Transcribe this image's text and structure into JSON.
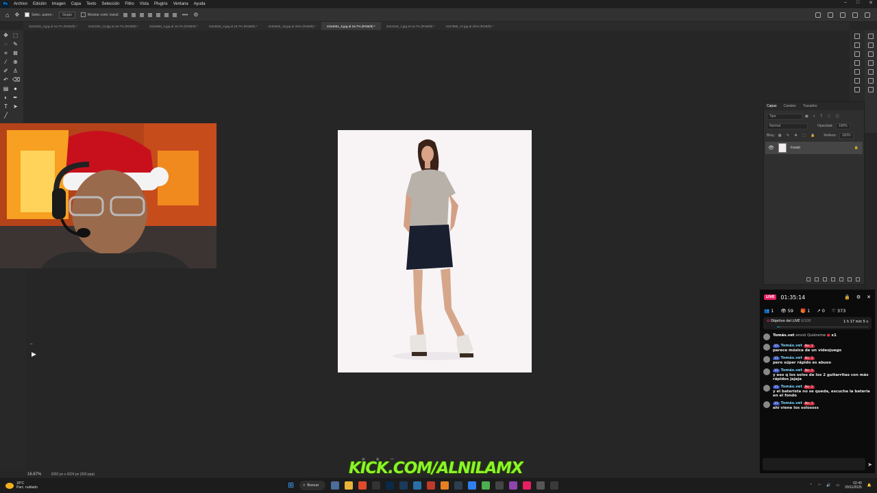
{
  "menu": [
    "Archivo",
    "Edición",
    "Imagen",
    "Capa",
    "Texto",
    "Selección",
    "Filtro",
    "Vista",
    "Plugins",
    "Ventana",
    "Ayuda"
  ],
  "options": {
    "autoselect": "Selec. autom.:",
    "group": "Grupo",
    "transform": "Mostrar contr. transf."
  },
  "tabs": [
    "3152230_3.jpg al 16.7% (RGB/8) *",
    "3152230_13.jpg al 16.7% (RGB/8) *",
    "3152980_2.jpg al 16.7% (RGB/8) *",
    "3153526_3.jpg al 16.7% (RGB/8) *",
    "3153526_15.jpg al 25% (RGB/8) *",
    "3154061_5.jpg al 16.7% (RGB/8) *",
    "3154346_1.jpg al 16.7% (RGB/8) *",
    "3157898_17.jpg al 25% (RGB/8) *"
  ],
  "active_tab": 5,
  "status": {
    "zoom": "16.67%",
    "info": "3392 px x 4224 px (300 ppp)"
  },
  "layers_panel": {
    "tabs": [
      "Capas",
      "Canales",
      "Trazados"
    ],
    "search_placeholder": "Tipo",
    "blend": "Normal",
    "opacity_label": "Opacidad:",
    "opacity": "100%",
    "lock_label": "Bloq.:",
    "fill_label": "Relleno:",
    "fill": "100%",
    "layer_name": "Fondo"
  },
  "chat": {
    "live": "LIVE",
    "timer": "01:35:14",
    "stats": {
      "a": "1",
      "b": "59",
      "c": "1",
      "d": "0",
      "e": "373"
    },
    "goal": {
      "label": "Objetivo del LIVE",
      "count": "0/100",
      "time": "1 h 17 min 5 s",
      "progress": 0.0
    },
    "gift": {
      "user": "Tomás.vet",
      "text": "envió Quiéreme",
      "count": "x1"
    },
    "messages": [
      {
        "level": "15",
        "user": "Tomás.vet",
        "rank": "No. 1",
        "text": "parece música de un videojuego"
      },
      {
        "level": "15",
        "user": "Tomás.vet",
        "rank": "No. 1",
        "text": "pero súper rápido es abuso"
      },
      {
        "level": "15",
        "user": "Tomás.vet",
        "rank": "No. 1",
        "text": "y eso q los solos de los 2 guitarritas con más rápidos jajaja"
      },
      {
        "level": "15",
        "user": "Tomás.vet",
        "rank": "No. 1",
        "text": "y el baterista no se queda, escucha la batería en el fondo"
      },
      {
        "level": "15",
        "user": "Tomás.vet",
        "rank": "No. 1",
        "text": "ahí viene los solossss"
      }
    ]
  },
  "overlay_text": "KICK.COM/ALNILAMX",
  "taskbar": {
    "temp": "18°C",
    "weather": "Parc. nublado",
    "search": "Buscar",
    "time": "02:40",
    "date": "20/11/2025"
  }
}
